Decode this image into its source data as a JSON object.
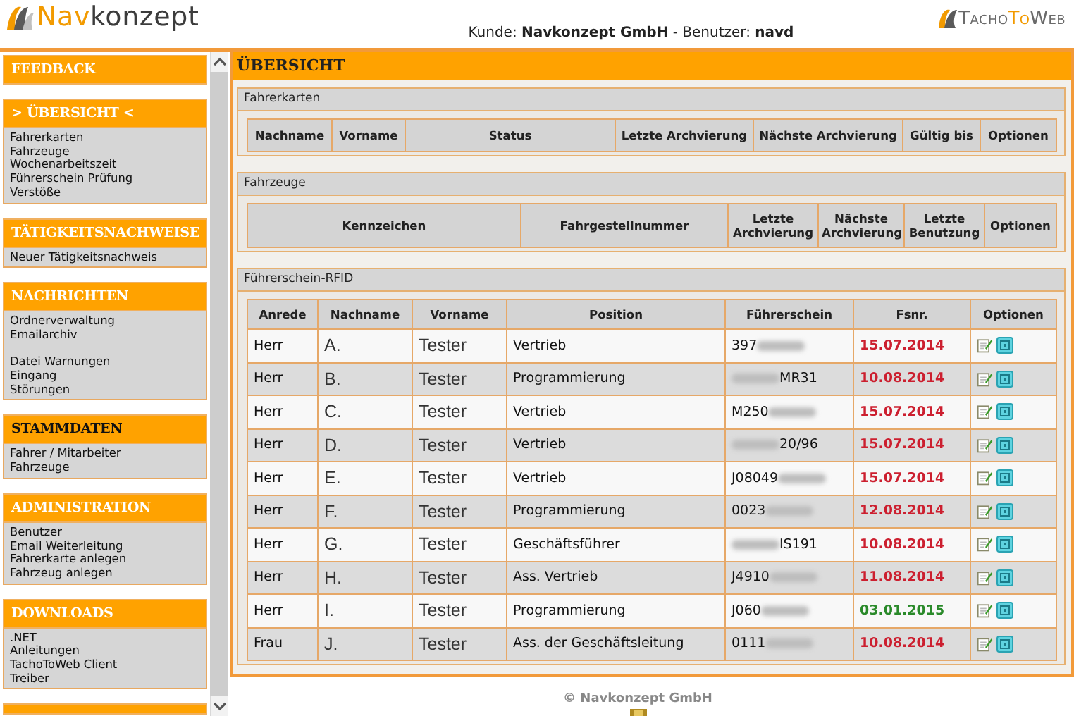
{
  "header": {
    "logo_parts": [
      "Nav",
      "konzept"
    ],
    "account": "Kunde: **Navkonzept GmbH** - Benutzer: **navd**",
    "brand_parts": [
      "Tacho",
      "To",
      "Web"
    ]
  },
  "sidebar": [
    {
      "title": "FEEDBACK",
      "highlighted": false
    },
    {
      "title": "> ÜBERSICHT <",
      "highlighted": false,
      "groups": [
        [
          "Fahrerkarten",
          "Fahrzeuge",
          "Wochenarbeitszeit",
          "Führerschein Prüfung",
          "Verstöße"
        ]
      ]
    },
    {
      "title": "TÄTIGKEITSNACHWEISE",
      "highlighted": false,
      "groups": [
        [
          "Neuer Tätigkeitsnachweis"
        ]
      ]
    },
    {
      "title": "NACHRICHTEN",
      "highlighted": false,
      "groups": [
        [
          "Ordnerverwaltung",
          "Emailarchiv"
        ],
        [
          "Datei Warnungen",
          "Eingang",
          "Störungen"
        ]
      ]
    },
    {
      "title": "STAMMDATEN",
      "highlighted": true,
      "groups": [
        [
          "Fahrer / Mitarbeiter",
          "Fahrzeuge"
        ]
      ]
    },
    {
      "title": "ADMINISTRATION",
      "highlighted": false,
      "groups": [
        [
          "Benutzer",
          "Email Weiterleitung",
          "Fahrerkarte anlegen",
          "Fahrzeug anlegen"
        ]
      ]
    },
    {
      "title": "DOWNLOADS",
      "highlighted": false,
      "groups": [
        [
          ".NET",
          "Anleitungen",
          "TachoToWeb Client",
          "Treiber"
        ]
      ]
    }
  ],
  "main": {
    "title": "ÜBERSICHT",
    "sections": [
      {
        "title": "Fahrerkarten",
        "kind": "empty",
        "columns": [
          "Nachname",
          "Vorname",
          "Status",
          "Letzte Archvierung",
          "Nächste Archvierung",
          "Gültig bis",
          "Optionen"
        ]
      },
      {
        "title": "Fahrzeuge",
        "kind": "empty",
        "columns": [
          "Kennzeichen",
          "Fahrgestellnummer",
          "Letzte Archvierung",
          "Nächste Archvierung",
          "Letzte Benutzung",
          "Optionen"
        ]
      },
      {
        "title": "Führerschein-RFID",
        "kind": "licenses",
        "columns": [
          "Anrede",
          "Nachname",
          "Vorname",
          "Position",
          "Führerschein",
          "Fsnr.",
          "Optionen"
        ],
        "rows": [
          {
            "anrede": "Herr",
            "nachname": "A.",
            "vorname": "Tester",
            "position": "Vertrieb",
            "license_before": "397",
            "fsnr": "15.07.2014",
            "color": "#cc1f2f"
          },
          {
            "anrede": "Herr",
            "nachname": "B.",
            "vorname": "Tester",
            "position": "Programmierung",
            "license_after": "MR31",
            "fsnr": "10.08.2014",
            "color": "#cc1f2f"
          },
          {
            "anrede": "Herr",
            "nachname": "C.",
            "vorname": "Tester",
            "position": "Vertrieb",
            "license_before": "M250",
            "fsnr": "15.07.2014",
            "color": "#cc1f2f"
          },
          {
            "anrede": "Herr",
            "nachname": "D.",
            "vorname": "Tester",
            "position": "Vertrieb",
            "license_after": "20/96",
            "fsnr": "15.07.2014",
            "color": "#cc1f2f"
          },
          {
            "anrede": "Herr",
            "nachname": "E.",
            "vorname": "Tester",
            "position": "Vertrieb",
            "license_before": "J08049",
            "fsnr": "15.07.2014",
            "color": "#cc1f2f"
          },
          {
            "anrede": "Herr",
            "nachname": "F.",
            "vorname": "Tester",
            "position": "Programmierung",
            "license_before": "0023",
            "fsnr": "12.08.2014",
            "color": "#cc1f2f"
          },
          {
            "anrede": "Herr",
            "nachname": "G.",
            "vorname": "Tester",
            "position": "Geschäftsführer",
            "license_after": "IS191",
            "fsnr": "10.08.2014",
            "color": "#cc1f2f"
          },
          {
            "anrede": "Herr",
            "nachname": "H.",
            "vorname": "Tester",
            "position": "Ass. Vertrieb",
            "license_before": "J4910",
            "fsnr": "11.08.2014",
            "color": "#cc1f2f"
          },
          {
            "anrede": "Herr",
            "nachname": "I.",
            "vorname": "Tester",
            "position": "Programmierung",
            "license_before": "J060",
            "fsnr": "03.01.2015",
            "color": "#2a8a2a"
          },
          {
            "anrede": "Frau",
            "nachname": "J.",
            "vorname": "Tester",
            "position": "Ass. der Geschäftsleitung",
            "license_before": "0111",
            "fsnr": "10.08.2014",
            "color": "#cc1f2f"
          }
        ]
      }
    ]
  },
  "footer": "© Navkonzept GmbH"
}
